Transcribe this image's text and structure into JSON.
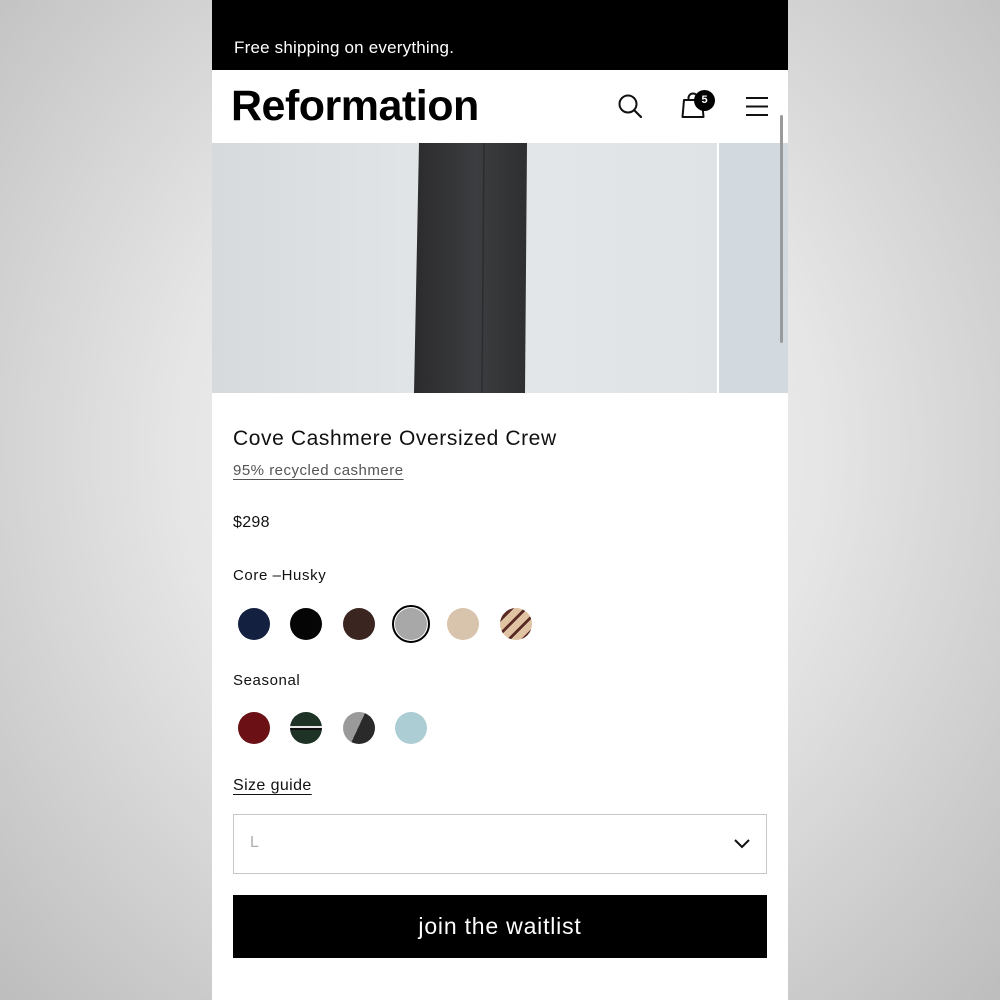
{
  "promo": {
    "text": "Free shipping on everything."
  },
  "header": {
    "brand": "Reformation",
    "cart_count": "5",
    "icons": [
      "search-icon",
      "shopping-bag-icon",
      "hamburger-menu-icon"
    ]
  },
  "product": {
    "title": "Cove Cashmere Oversized Crew",
    "material": "95% recycled cashmere",
    "price": "$298",
    "core_label": "Core –Husky",
    "core_colors": [
      {
        "name": "navy",
        "fill": "#14203f"
      },
      {
        "name": "black",
        "fill": "#050505"
      },
      {
        "name": "brown",
        "fill": "#3a2520"
      },
      {
        "name": "husky-grey",
        "fill": "#a8a8a8",
        "selected": true
      },
      {
        "name": "oatmeal",
        "fill": "#d8c3ad"
      },
      {
        "name": "oatmeal-stripe",
        "fill": "#dfc3a2",
        "stripe": "#5a2a24"
      }
    ],
    "seasonal_label": "Seasonal",
    "seasonal_colors": [
      {
        "name": "burgundy",
        "fill": "#6b1014"
      },
      {
        "name": "forest-stripe",
        "fill": "#1e3326",
        "stripe": "#e8e8e8"
      },
      {
        "name": "charcoal-argyle",
        "fill": "#2a2a2a",
        "stripe": "#9a9a9a"
      },
      {
        "name": "light-blue",
        "fill": "#abcdd3"
      }
    ]
  },
  "size": {
    "guide_label": "Size guide",
    "selected": "L"
  },
  "cta": {
    "label": "join the waitlist"
  }
}
